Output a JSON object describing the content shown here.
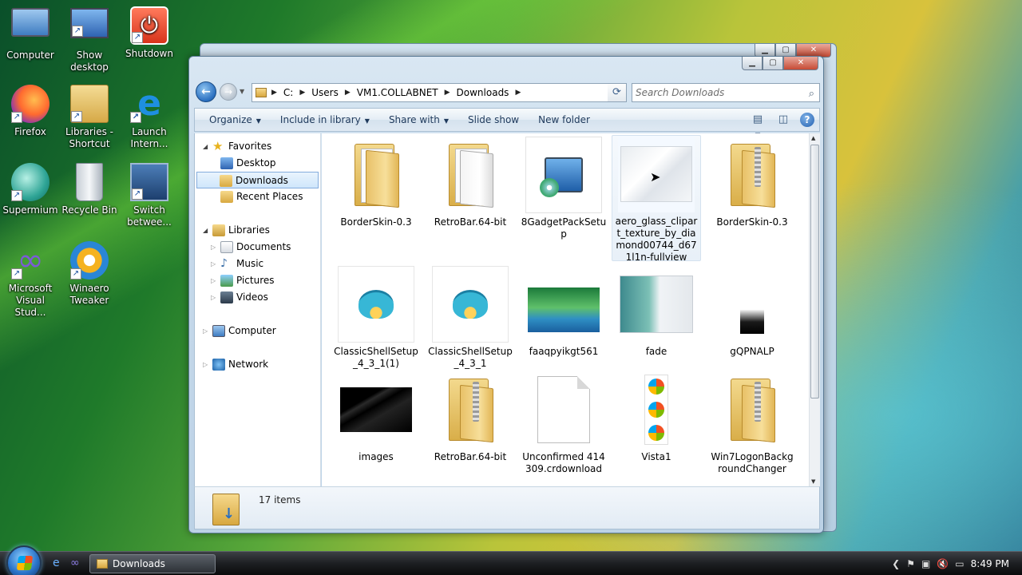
{
  "desktop": {
    "icons": [
      {
        "label": "Computer"
      },
      {
        "label": "Show desktop"
      },
      {
        "label": "Shutdown"
      },
      {
        "label": "Firefox"
      },
      {
        "label": "Libraries - Shortcut"
      },
      {
        "label": "Launch Intern..."
      },
      {
        "label": "Supermium"
      },
      {
        "label": "Recycle Bin"
      },
      {
        "label": "Switch betwee..."
      },
      {
        "label": "Microsoft Visual Stud..."
      },
      {
        "label": "Winaero Tweaker"
      }
    ]
  },
  "window": {
    "address": {
      "crumbs": [
        "C:",
        "Users",
        "VM1.COLLABNET",
        "Downloads"
      ]
    },
    "search": {
      "placeholder": "Search Downloads"
    },
    "toolbar": {
      "organize": "Organize",
      "include": "Include in library",
      "share": "Share with",
      "slideshow": "Slide show",
      "newfolder": "New folder"
    },
    "nav": {
      "favorites": "Favorites",
      "desktop": "Desktop",
      "downloads": "Downloads",
      "recent": "Recent Places",
      "libraries": "Libraries",
      "documents": "Documents",
      "music": "Music",
      "pictures": "Pictures",
      "videos": "Videos",
      "computer": "Computer",
      "network": "Network"
    },
    "files": [
      {
        "label": "BorderSkin-0.3"
      },
      {
        "label": "RetroBar.64-bit"
      },
      {
        "label": "8GadgetPackSetup"
      },
      {
        "label": "aero_glass_clipart_texture_by_diamond00744_d671l1n-fullview"
      },
      {
        "label": "BorderSkin-0.3"
      },
      {
        "label": "ClassicShellSetup_4_3_1(1)"
      },
      {
        "label": "ClassicShellSetup_4_3_1"
      },
      {
        "label": "faaqpyikgt561"
      },
      {
        "label": "fade"
      },
      {
        "label": "gQPNALP"
      },
      {
        "label": "images"
      },
      {
        "label": "RetroBar.64-bit"
      },
      {
        "label": "Unconfirmed 414309.crdownload"
      },
      {
        "label": "Vista1"
      },
      {
        "label": "Win7LogonBackgroundChanger"
      }
    ],
    "status": {
      "count": "17 items"
    }
  },
  "taskbar": {
    "task": "Downloads",
    "clock": "8:49 PM"
  },
  "colors": {
    "accent": "#2a6fc0",
    "selection": "#cfe6fb"
  }
}
